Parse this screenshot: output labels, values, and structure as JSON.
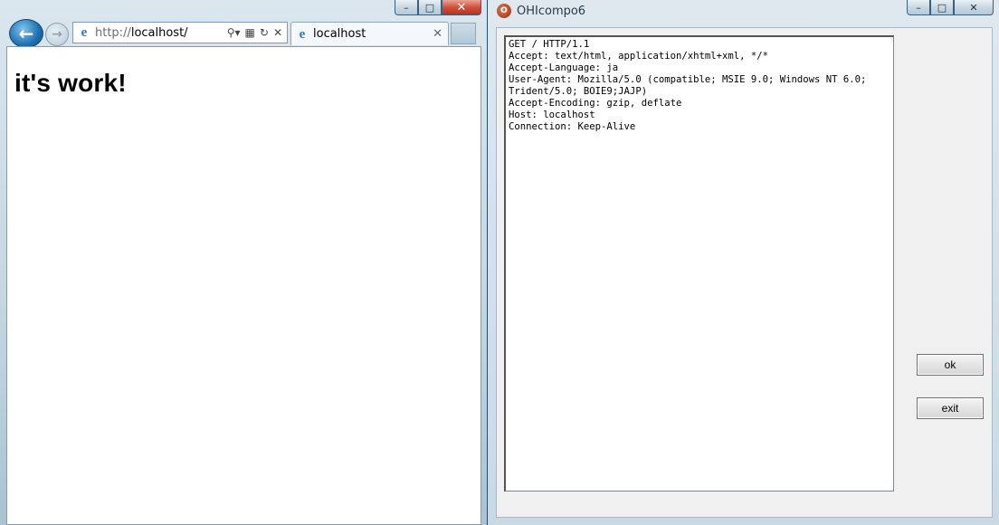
{
  "browser": {
    "url_scheme": "http://",
    "url_host": "localhost/",
    "tab_label": "localhost",
    "page_heading": "it's work!",
    "icons": {
      "back": "back-arrow-icon",
      "forward": "forward-arrow-icon",
      "search": "search-icon",
      "compat": "compatibility-view-icon",
      "refresh": "refresh-icon",
      "stop": "stop-icon"
    }
  },
  "app": {
    "title": "OHIcompo6",
    "request_text": "GET / HTTP/1.1\nAccept: text/html, application/xhtml+xml, */*\nAccept-Language: ja\nUser-Agent: Mozilla/5.0 (compatible; MSIE 9.0; Windows NT 6.0;\nTrident/5.0; BOIE9;JAJP)\nAccept-Encoding: gzip, deflate\nHost: localhost\nConnection: Keep-Alive",
    "ok_label": "ok",
    "exit_label": "exit"
  },
  "colors": {
    "desktop_accent": "#2a8a8c",
    "ie_blue": "#1f6fb2",
    "close_red": "#c8432d"
  }
}
